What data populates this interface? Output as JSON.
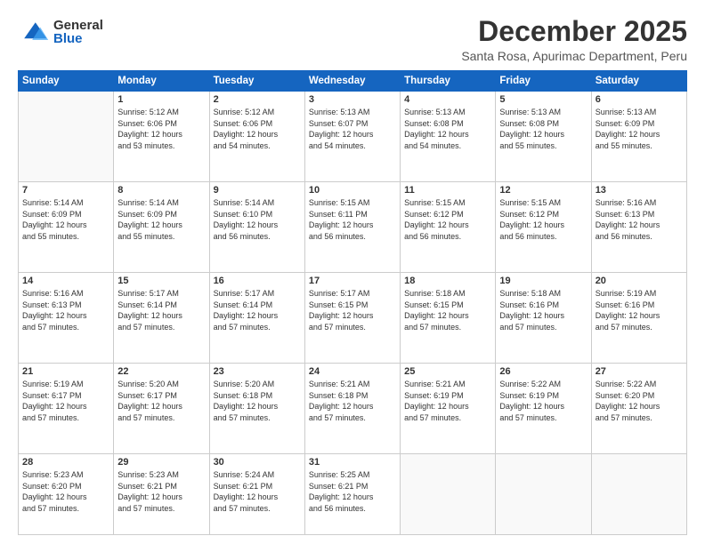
{
  "logo": {
    "general": "General",
    "blue": "Blue"
  },
  "title": "December 2025",
  "subtitle": "Santa Rosa, Apurimac Department, Peru",
  "weekdays": [
    "Sunday",
    "Monday",
    "Tuesday",
    "Wednesday",
    "Thursday",
    "Friday",
    "Saturday"
  ],
  "weeks": [
    [
      {
        "day": "",
        "info": ""
      },
      {
        "day": "1",
        "info": "Sunrise: 5:12 AM\nSunset: 6:06 PM\nDaylight: 12 hours\nand 53 minutes."
      },
      {
        "day": "2",
        "info": "Sunrise: 5:12 AM\nSunset: 6:06 PM\nDaylight: 12 hours\nand 54 minutes."
      },
      {
        "day": "3",
        "info": "Sunrise: 5:13 AM\nSunset: 6:07 PM\nDaylight: 12 hours\nand 54 minutes."
      },
      {
        "day": "4",
        "info": "Sunrise: 5:13 AM\nSunset: 6:08 PM\nDaylight: 12 hours\nand 54 minutes."
      },
      {
        "day": "5",
        "info": "Sunrise: 5:13 AM\nSunset: 6:08 PM\nDaylight: 12 hours\nand 55 minutes."
      },
      {
        "day": "6",
        "info": "Sunrise: 5:13 AM\nSunset: 6:09 PM\nDaylight: 12 hours\nand 55 minutes."
      }
    ],
    [
      {
        "day": "7",
        "info": ""
      },
      {
        "day": "8",
        "info": "Sunrise: 5:14 AM\nSunset: 6:09 PM\nDaylight: 12 hours\nand 55 minutes."
      },
      {
        "day": "9",
        "info": "Sunrise: 5:14 AM\nSunset: 6:10 PM\nDaylight: 12 hours\nand 56 minutes."
      },
      {
        "day": "10",
        "info": "Sunrise: 5:15 AM\nSunset: 6:11 PM\nDaylight: 12 hours\nand 56 minutes."
      },
      {
        "day": "11",
        "info": "Sunrise: 5:15 AM\nSunset: 6:12 PM\nDaylight: 12 hours\nand 56 minutes."
      },
      {
        "day": "12",
        "info": "Sunrise: 5:15 AM\nSunset: 6:12 PM\nDaylight: 12 hours\nand 56 minutes."
      },
      {
        "day": "13",
        "info": "Sunrise: 5:16 AM\nSunset: 6:13 PM\nDaylight: 12 hours\nand 56 minutes."
      }
    ],
    [
      {
        "day": "14",
        "info": ""
      },
      {
        "day": "15",
        "info": "Sunrise: 5:17 AM\nSunset: 6:14 PM\nDaylight: 12 hours\nand 57 minutes."
      },
      {
        "day": "16",
        "info": "Sunrise: 5:17 AM\nSunset: 6:14 PM\nDaylight: 12 hours\nand 57 minutes."
      },
      {
        "day": "17",
        "info": "Sunrise: 5:17 AM\nSunset: 6:15 PM\nDaylight: 12 hours\nand 57 minutes."
      },
      {
        "day": "18",
        "info": "Sunrise: 5:18 AM\nSunset: 6:15 PM\nDaylight: 12 hours\nand 57 minutes."
      },
      {
        "day": "19",
        "info": "Sunrise: 5:18 AM\nSunset: 6:16 PM\nDaylight: 12 hours\nand 57 minutes."
      },
      {
        "day": "20",
        "info": "Sunrise: 5:19 AM\nSunset: 6:16 PM\nDaylight: 12 hours\nand 57 minutes."
      }
    ],
    [
      {
        "day": "21",
        "info": ""
      },
      {
        "day": "22",
        "info": "Sunrise: 5:20 AM\nSunset: 6:17 PM\nDaylight: 12 hours\nand 57 minutes."
      },
      {
        "day": "23",
        "info": "Sunrise: 5:20 AM\nSunset: 6:18 PM\nDaylight: 12 hours\nand 57 minutes."
      },
      {
        "day": "24",
        "info": "Sunrise: 5:21 AM\nSunset: 6:18 PM\nDaylight: 12 hours\nand 57 minutes."
      },
      {
        "day": "25",
        "info": "Sunrise: 5:21 AM\nSunset: 6:19 PM\nDaylight: 12 hours\nand 57 minutes."
      },
      {
        "day": "26",
        "info": "Sunrise: 5:22 AM\nSunset: 6:19 PM\nDaylight: 12 hours\nand 57 minutes."
      },
      {
        "day": "27",
        "info": "Sunrise: 5:22 AM\nSunset: 6:20 PM\nDaylight: 12 hours\nand 57 minutes."
      }
    ],
    [
      {
        "day": "28",
        "info": "Sunrise: 5:23 AM\nSunset: 6:20 PM\nDaylight: 12 hours\nand 57 minutes."
      },
      {
        "day": "29",
        "info": "Sunrise: 5:23 AM\nSunset: 6:21 PM\nDaylight: 12 hours\nand 57 minutes."
      },
      {
        "day": "30",
        "info": "Sunrise: 5:24 AM\nSunset: 6:21 PM\nDaylight: 12 hours\nand 57 minutes."
      },
      {
        "day": "31",
        "info": "Sunrise: 5:25 AM\nSunset: 6:21 PM\nDaylight: 12 hours\nand 56 minutes."
      },
      {
        "day": "",
        "info": ""
      },
      {
        "day": "",
        "info": ""
      },
      {
        "day": "",
        "info": ""
      }
    ]
  ],
  "week1_day7_info": "Sunrise: 5:14 AM\nSunset: 6:09 PM\nDaylight: 12 hours\nand 55 minutes.",
  "week3_day14_info": "Sunrise: 5:16 AM\nSunset: 6:13 PM\nDaylight: 12 hours\nand 57 minutes.",
  "week4_day21_info": "Sunrise: 5:19 AM\nSunset: 6:17 PM\nDaylight: 12 hours\nand 57 minutes."
}
